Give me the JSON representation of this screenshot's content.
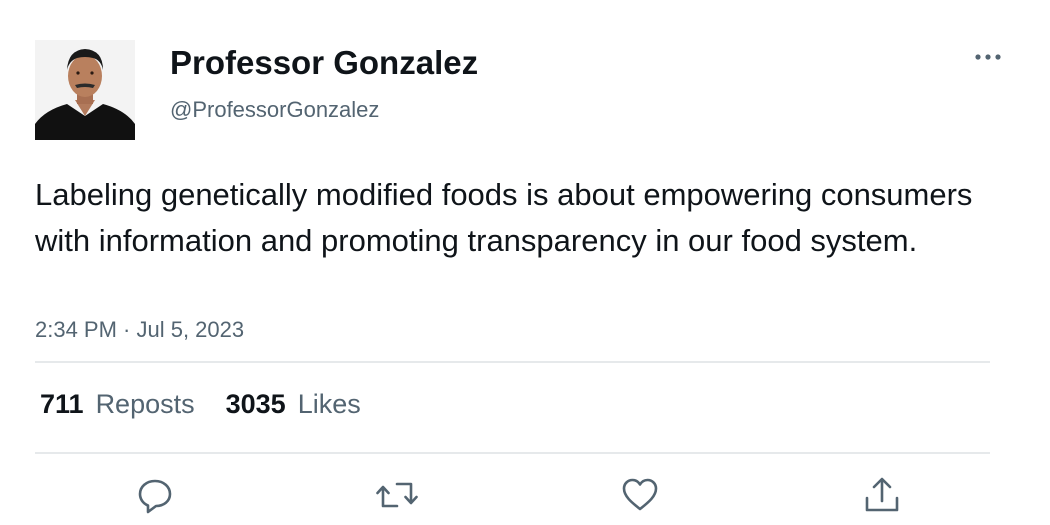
{
  "author": {
    "display_name": "Professor Gonzalez",
    "handle": "@ProfessorGonzalez",
    "avatar_icon": "profile-photo"
  },
  "tweet": {
    "text": "Labeling genetically modified foods is about empowering consumers with information and promoting transparency in our food system.",
    "timestamp": "2:34 PM · Jul 5, 2023"
  },
  "stats": {
    "reposts_count": "711",
    "reposts_label": "Reposts",
    "likes_count": "3035",
    "likes_label": "Likes"
  },
  "actions": {
    "more_icon": "more-icon",
    "reply_icon": "reply-icon",
    "repost_icon": "repost-icon",
    "like_icon": "like-icon",
    "share_icon": "share-icon"
  },
  "colors": {
    "text_primary": "#0f1419",
    "text_secondary": "#536471",
    "divider": "#e6e9eb"
  }
}
